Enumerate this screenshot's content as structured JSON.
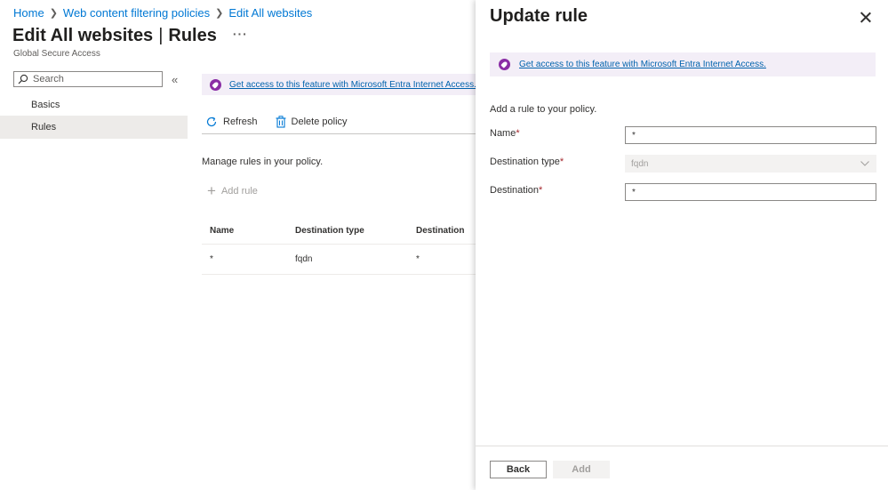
{
  "breadcrumb": [
    "Home",
    "Web content filtering policies",
    "Edit All websites"
  ],
  "page": {
    "title_main": "Edit All websites",
    "title_section": "Rules",
    "more": "···",
    "subtitle": "Global Secure Access"
  },
  "nav": {
    "search_placeholder": "Search",
    "collapse": "«",
    "items": [
      {
        "label": "Basics",
        "active": false
      },
      {
        "label": "Rules",
        "active": true
      }
    ]
  },
  "banner": {
    "link_text": "Get access to this feature with Microsoft Entra Internet Access."
  },
  "toolbar": {
    "refresh_label": "Refresh",
    "delete_label": "Delete policy"
  },
  "main": {
    "manage_text": "Manage rules in your policy.",
    "add_rule_label": "Add rule"
  },
  "table": {
    "columns": [
      "Name",
      "Destination type",
      "Destination"
    ],
    "rows": [
      [
        "*",
        "fqdn",
        "*"
      ]
    ]
  },
  "panel": {
    "title": "Update rule",
    "banner_link": "Get access to this feature with Microsoft Entra Internet Access.",
    "intro": "Add a rule to your policy.",
    "fields": {
      "name_label": "Name",
      "name_value": "*",
      "dest_type_label": "Destination type",
      "dest_type_value": "fqdn",
      "destination_label": "Destination",
      "destination_value": "*"
    },
    "back_label": "Back",
    "add_label": "Add"
  },
  "colors": {
    "link": "#0078d4",
    "accent_purple": "#8a2da5",
    "banner_bg": "#f3eef7",
    "required": "#a4262c"
  }
}
